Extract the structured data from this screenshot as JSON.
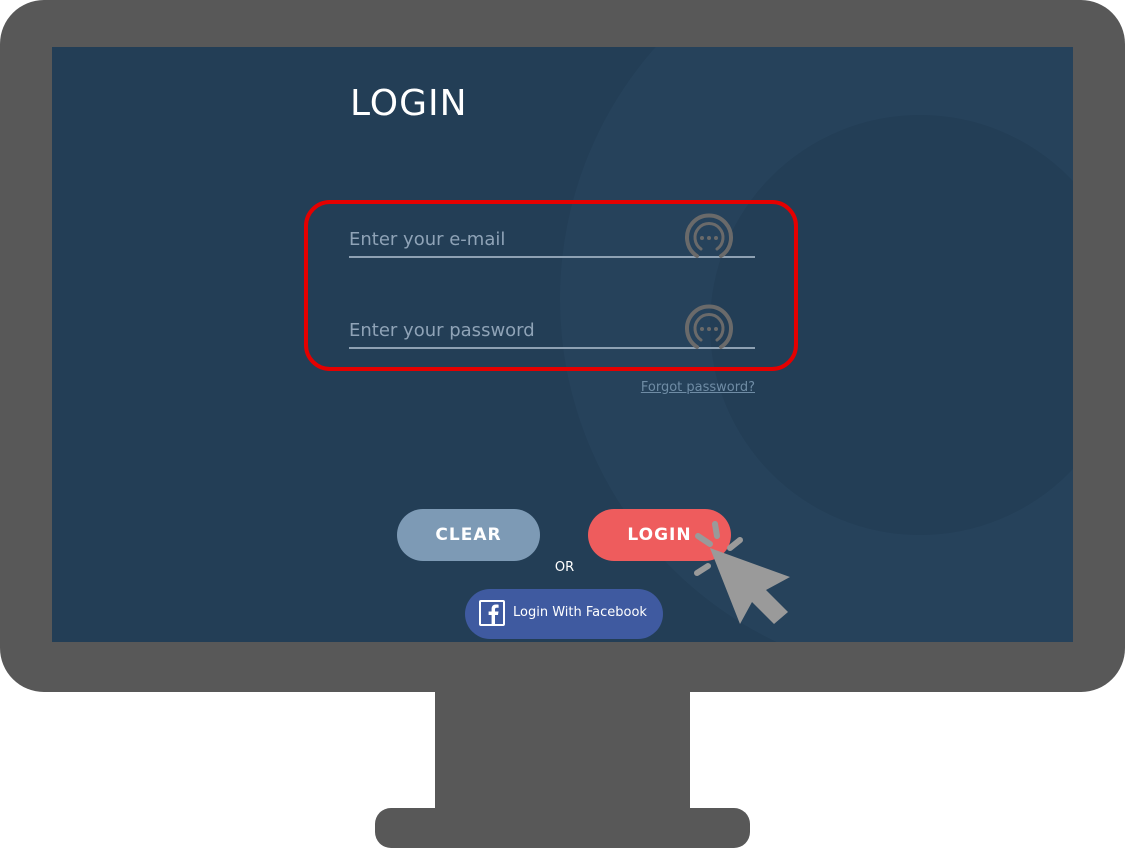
{
  "login_form": {
    "title": "LOGIN",
    "email_placeholder": "Enter your e-mail",
    "password_placeholder": "Enter your password",
    "field_icon": "password-dots-icon",
    "forgot_password": "Forgot password?",
    "clear_label": "CLEAR",
    "login_label": "LOGIN",
    "or_label": "OR",
    "facebook_label": "Login With Facebook"
  },
  "icons": {
    "facebook": "facebook-f-icon",
    "cursor": "mouse-pointer-click-icon"
  },
  "colors": {
    "screen_background": "#233e56",
    "clear_button": "#7d9ab5",
    "login_button": "#ee5c5d",
    "facebook_button": "#3f5aa0",
    "highlight": "#e50000",
    "monitor": "#585858"
  }
}
